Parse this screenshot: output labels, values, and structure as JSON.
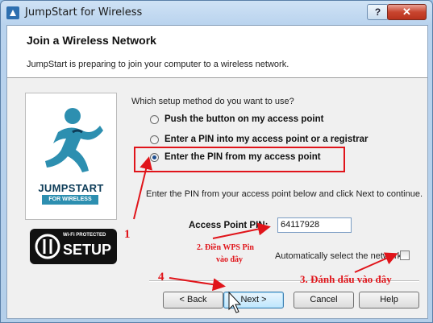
{
  "window": {
    "title": "JumpStart for Wireless",
    "help_button": "?",
    "close_button": "✕"
  },
  "header": {
    "title": "Join a Wireless Network",
    "description": "JumpStart is preparing to join your computer to a wireless network."
  },
  "logo": {
    "brand_word": "JUMPSTART",
    "brand_sub": "FOR WIRELESS",
    "wps_top": "Wi-Fi PROTECTED",
    "wps_setup": "SETUP"
  },
  "form": {
    "question": "Which setup method do you want to use?",
    "options": [
      {
        "label": "Push the button on my access point",
        "checked": false
      },
      {
        "label": "Enter a PIN into my access point or a registrar",
        "checked": false
      },
      {
        "label": "Enter the PIN from my access point",
        "checked": true
      }
    ],
    "instruction": "Enter the PIN from your access point below and click Next to continue.",
    "pin_label": "Access Point PIN:",
    "pin_value": "64117928",
    "auto_select_label": "Automatically select the network",
    "auto_select_checked": false
  },
  "buttons": {
    "back": "< Back",
    "next": "Next >",
    "cancel": "Cancel",
    "help": "Help"
  },
  "annotations": {
    "a1": "1",
    "a2_line1": "2. Điền WPS Pin",
    "a2_line2": "vào đây",
    "a3": "3. Đánh dấu vào đây",
    "a4": "4"
  },
  "colors": {
    "annotation_red": "#e0141a",
    "title_gradient": "#b9d3ee",
    "close_red": "#c8452f"
  }
}
